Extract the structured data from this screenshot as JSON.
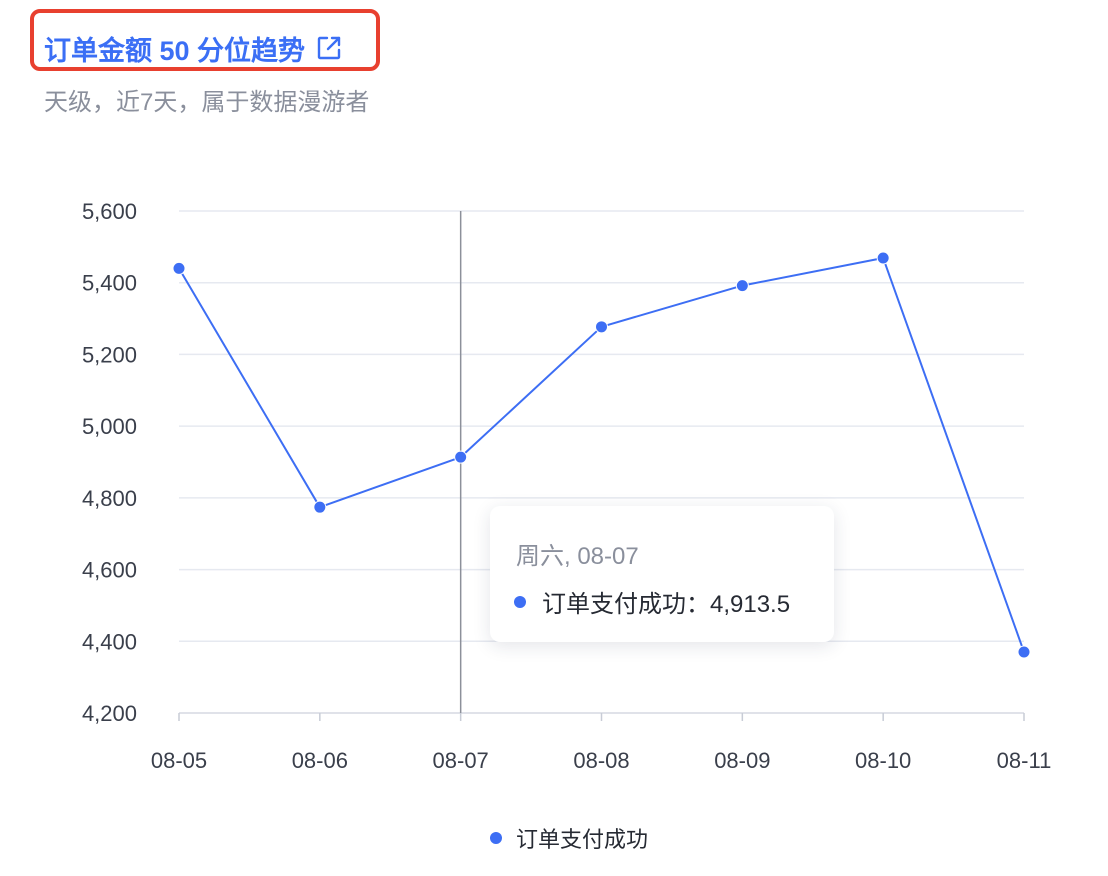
{
  "header": {
    "title": "订单金额 50 分位趋势",
    "subtitle": "天级，近7天，属于数据漫游者",
    "title_icon": "external-link-icon",
    "highlight_color": "#e8402f",
    "title_color": "#3b6ff5"
  },
  "chart_data": {
    "type": "line",
    "categories": [
      "08-05",
      "08-06",
      "08-07",
      "08-08",
      "08-09",
      "08-10",
      "08-11"
    ],
    "series": [
      {
        "name": "订单支付成功",
        "color": "#3d6ef4",
        "values": [
          5440,
          4774,
          4913.5,
          5277,
          5392,
          5469,
          4370
        ]
      }
    ],
    "ylim": [
      4200,
      5600
    ],
    "yticks": [
      4200,
      4400,
      4600,
      4800,
      5000,
      5200,
      5400,
      5600
    ],
    "ytick_labels": [
      "4,200",
      "4,400",
      "4,600",
      "4,800",
      "5,000",
      "5,200",
      "5,400",
      "5,600"
    ],
    "grid": true,
    "legend_position": "bottom",
    "crosshair_category": "08-07"
  },
  "tooltip": {
    "date": "周六, 08-07",
    "series_label": "订单支付成功",
    "separator": "：",
    "value": "4,913.5"
  },
  "legend": {
    "label": "订单支付成功"
  }
}
